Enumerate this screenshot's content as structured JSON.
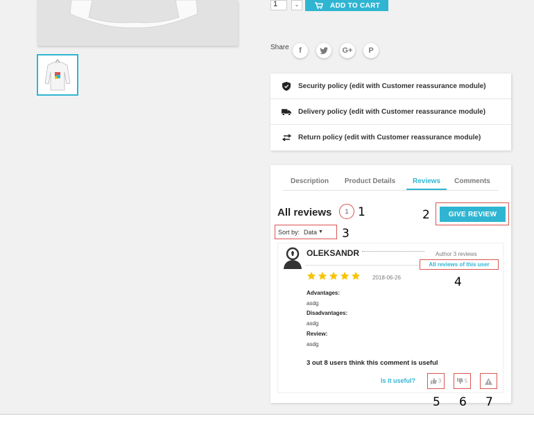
{
  "product": {
    "qty_value": "1",
    "add_to_cart_label": "ADD TO CART"
  },
  "share": {
    "label": "Share",
    "buttons": [
      "f",
      "t",
      "G+",
      "P"
    ]
  },
  "reassurance": [
    {
      "icon": "shield-icon",
      "text": "Security policy (edit with Customer reassurance module)"
    },
    {
      "icon": "truck-icon",
      "text": "Delivery policy (edit with Customer reassurance module)"
    },
    {
      "icon": "return-arrows-icon",
      "text": "Return policy (edit with Customer reassurance module)"
    }
  ],
  "tabs": [
    {
      "label": "Description",
      "active": false
    },
    {
      "label": "Product Details",
      "active": false
    },
    {
      "label": "Reviews",
      "active": true
    },
    {
      "label": "Comments",
      "active": false
    }
  ],
  "reviews": {
    "heading": "All reviews",
    "count": "1",
    "give_review_label": "GIVE REVIEW",
    "sort_label": "Sort by:",
    "sort_value": "Data",
    "item": {
      "username": "OLEKSANDR",
      "author_info": "Author 3 reviews",
      "all_reviews_link": "All reviews of this user",
      "rating": 5,
      "date": "2018-06-26",
      "advantages_label": "Advantages:",
      "advantages": "asdg",
      "disadvantages_label": "Disadvantages:",
      "disadvantages": "asdg",
      "review_label": "Review:",
      "review": "asdg",
      "useful_summary": "3 out 8 users think this comment is useful",
      "is_useful_label": "Is it useful?",
      "likes": "3",
      "dislikes": "5"
    }
  },
  "annotations": [
    "1",
    "2",
    "3",
    "4",
    "5",
    "6",
    "7"
  ],
  "colors": {
    "accent": "#2fb5d2",
    "annotation_red": "#d9534f",
    "star": "#f7c400"
  }
}
